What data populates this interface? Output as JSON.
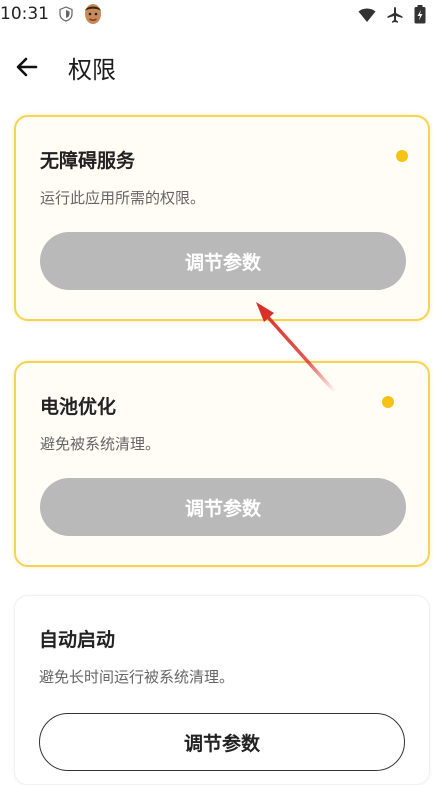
{
  "status_bar": {
    "time": "10:31"
  },
  "header": {
    "back_label": "",
    "title": "权限"
  },
  "cards": [
    {
      "title": "无障碍服务",
      "description": "运行此应用所需的权限。",
      "button": "调节参数",
      "status": "warning"
    },
    {
      "title": "电池优化",
      "description": "避免被系统清理。",
      "button": "调节参数",
      "status": "warning"
    },
    {
      "title": "自动启动",
      "description": "避免长时间运行被系统清理。",
      "button": "调节参数",
      "status": "normal"
    }
  ],
  "colors": {
    "warning_border": "#f5d455",
    "warning_dot": "#f5c317",
    "button_gray": "#b9b9b9",
    "annotation_arrow": "#d9302a"
  },
  "icons": [
    "shield-icon",
    "avatar-icon",
    "wifi-icon",
    "airplane-icon",
    "battery-icon",
    "back-arrow-icon"
  ]
}
